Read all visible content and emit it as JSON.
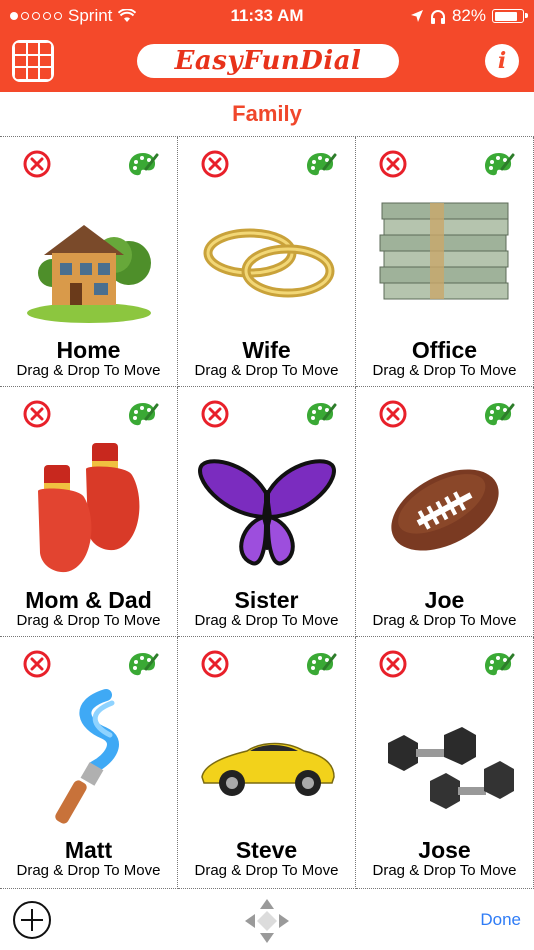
{
  "status_bar": {
    "carrier": "Sprint",
    "time": "11:33 AM",
    "battery": "82%",
    "battery_level": 0.82,
    "signal_bars_filled": 1,
    "signal_bars_total": 5
  },
  "header": {
    "app_title": "EasyFunDial",
    "grid_icon": "grid-icon",
    "info_icon": "info-icon",
    "info_glyph": "i",
    "brand_color": "#f4492a"
  },
  "page": {
    "title": "Family"
  },
  "contacts": [
    {
      "name": "Home",
      "hint": "Drag & Drop To Move",
      "icon": "house-icon"
    },
    {
      "name": "Wife",
      "hint": "Drag & Drop To Move",
      "icon": "rings-icon"
    },
    {
      "name": "Office",
      "hint": "Drag & Drop To Move",
      "icon": "money-stack-icon"
    },
    {
      "name": "Mom & Dad",
      "hint": "Drag & Drop To Move",
      "icon": "boxing-gloves-icon"
    },
    {
      "name": "Sister",
      "hint": "Drag & Drop To Move",
      "icon": "butterfly-icon"
    },
    {
      "name": "Joe",
      "hint": "Drag & Drop To Move",
      "icon": "football-icon"
    },
    {
      "name": "Matt",
      "hint": "Drag & Drop To Move",
      "icon": "paintbrush-icon"
    },
    {
      "name": "Steve",
      "hint": "Drag & Drop To Move",
      "icon": "sports-car-icon"
    },
    {
      "name": "Jose",
      "hint": "Drag & Drop To Move",
      "icon": "dumbbells-icon"
    }
  ],
  "cell_actions": {
    "delete_icon": "delete-icon",
    "palette_icon": "palette-icon"
  },
  "bottom_bar": {
    "add_icon": "add-icon",
    "move_icon": "move-arrows-icon",
    "done_label": "Done"
  }
}
